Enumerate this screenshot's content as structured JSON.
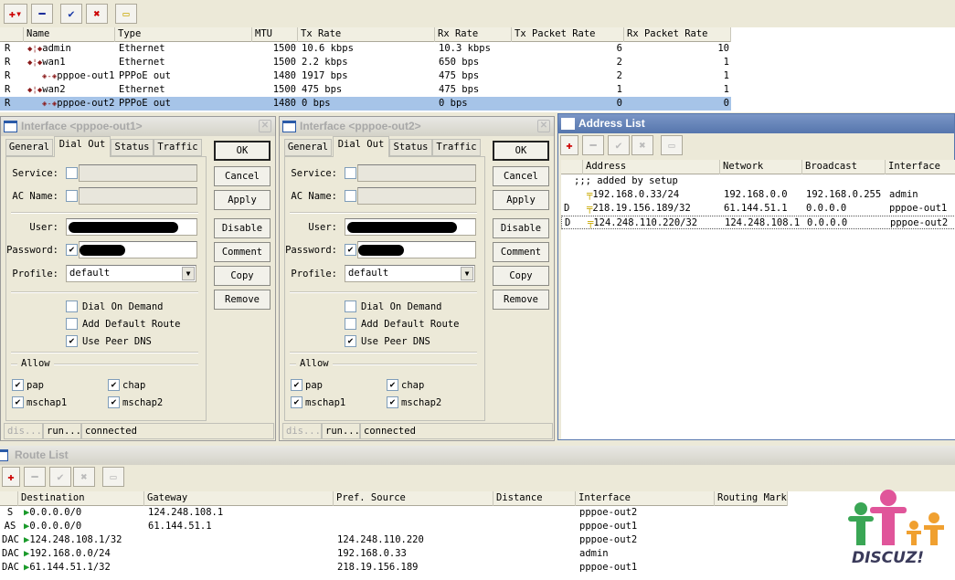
{
  "toolbar": {
    "buttons": [
      {
        "name": "add-menu-button",
        "icon": "plus-dropdown-icon",
        "glyph": "✚▾",
        "color": "#cc0000"
      },
      {
        "name": "remove-button",
        "icon": "minus-icon",
        "glyph": "━",
        "color": "#1a2a9a"
      },
      {
        "name": "enable-button",
        "icon": "check-icon",
        "glyph": "✔",
        "color": "#1a3aa8"
      },
      {
        "name": "disable-button",
        "icon": "x-icon",
        "glyph": "✖",
        "color": "#cc0000"
      },
      {
        "name": "comment-button",
        "icon": "note-icon",
        "glyph": "▭",
        "color": "#c9a800"
      }
    ]
  },
  "interfaces": {
    "columns": [
      "",
      "Name",
      "Type",
      "MTU",
      "Tx Rate",
      "Rx Rate",
      "Tx Packet Rate",
      "Rx Packet Rate"
    ],
    "rows": [
      {
        "flag": "R",
        "name": "admin",
        "indent": false,
        "type": "Ethernet",
        "mtu": "1500",
        "tx": "10.6 kbps",
        "rx": "10.3 kbps",
        "txp": "6",
        "rxp": "10"
      },
      {
        "flag": "R",
        "name": "wan1",
        "indent": false,
        "type": "Ethernet",
        "mtu": "1500",
        "tx": "2.2 kbps",
        "rx": "650 bps",
        "txp": "2",
        "rxp": "1"
      },
      {
        "flag": "R",
        "name": "pppoe-out1",
        "indent": true,
        "type": "PPPoE out",
        "mtu": "1480",
        "tx": "1917 bps",
        "rx": "475 bps",
        "txp": "2",
        "rxp": "1"
      },
      {
        "flag": "R",
        "name": "wan2",
        "indent": false,
        "type": "Ethernet",
        "mtu": "1500",
        "tx": "475 bps",
        "rx": "475 bps",
        "txp": "1",
        "rxp": "1"
      },
      {
        "flag": "R",
        "name": "pppoe-out2",
        "indent": true,
        "type": "PPPoE out",
        "mtu": "1480",
        "tx": "0 bps",
        "rx": "0 bps",
        "txp": "0",
        "rxp": "0",
        "selected": true
      }
    ]
  },
  "dialogs": [
    {
      "title": "Interface <pppoe-out1>",
      "tabs": [
        "General",
        "Dial Out",
        "Status",
        "Traffic"
      ],
      "active_tab": "Dial Out",
      "labels": {
        "service": "Service:",
        "ac_name": "AC Name:",
        "user": "User:",
        "password": "Password:",
        "profile": "Profile:"
      },
      "profile": "default",
      "dial_on_demand": "Dial On Demand",
      "add_default_route": "Add Default Route",
      "use_peer_dns": "Use Peer DNS",
      "allow": "Allow",
      "pap": "pap",
      "chap": "chap",
      "mschap1": "mschap1",
      "mschap2": "mschap2",
      "buttons": [
        "OK",
        "Cancel",
        "Apply",
        "Disable",
        "Comment",
        "Copy",
        "Remove"
      ],
      "status": [
        "dis...",
        "run...",
        "connected"
      ]
    },
    {
      "title": "Interface <pppoe-out2>",
      "tabs": [
        "General",
        "Dial Out",
        "Status",
        "Traffic"
      ],
      "active_tab": "Dial Out",
      "labels": {
        "service": "Service:",
        "ac_name": "AC Name:",
        "user": "User:",
        "password": "Password:",
        "profile": "Profile:"
      },
      "profile": "default",
      "dial_on_demand": "Dial On Demand",
      "add_default_route": "Add Default Route",
      "use_peer_dns": "Use Peer DNS",
      "allow": "Allow",
      "pap": "pap",
      "chap": "chap",
      "mschap1": "mschap1",
      "mschap2": "mschap2",
      "buttons": [
        "OK",
        "Cancel",
        "Apply",
        "Disable",
        "Comment",
        "Copy",
        "Remove"
      ],
      "status": [
        "dis...",
        "run...",
        "connected"
      ]
    }
  ],
  "address_list": {
    "title": "Address List",
    "columns": [
      "",
      "Address",
      "Network",
      "Broadcast",
      "Interface"
    ],
    "comment": ";;; added by setup",
    "rows": [
      {
        "flag": "",
        "address": "192.168.0.33/24",
        "network": "192.168.0.0",
        "broadcast": "192.168.0.255",
        "interface": "admin"
      },
      {
        "flag": "D",
        "address": "218.19.156.189/32",
        "network": "61.144.51.1",
        "broadcast": "0.0.0.0",
        "interface": "pppoe-out1"
      },
      {
        "flag": "D",
        "address": "124.248.110.220/32",
        "network": "124.248.108.1",
        "broadcast": "0.0.0.0",
        "interface": "pppoe-out2"
      }
    ]
  },
  "route_list": {
    "title": "Route List",
    "columns": [
      "",
      "Destination",
      "Gateway",
      "Pref. Source",
      "Distance",
      "Interface",
      "Routing Mark"
    ],
    "rows": [
      {
        "flag": "S",
        "dst": "0.0.0.0/0",
        "gw": "124.248.108.1",
        "src": "",
        "dist": "",
        "iface": "pppoe-out2",
        "mark": ""
      },
      {
        "flag": "AS",
        "dst": "0.0.0.0/0",
        "gw": "61.144.51.1",
        "src": "",
        "dist": "",
        "iface": "pppoe-out1",
        "mark": ""
      },
      {
        "flag": "DAC",
        "dst": "124.248.108.1/32",
        "gw": "",
        "src": "124.248.110.220",
        "dist": "",
        "iface": "pppoe-out2",
        "mark": ""
      },
      {
        "flag": "DAC",
        "dst": "192.168.0.0/24",
        "gw": "",
        "src": "192.168.0.33",
        "dist": "",
        "iface": "admin",
        "mark": ""
      },
      {
        "flag": "DAC",
        "dst": "61.144.51.1/32",
        "gw": "",
        "src": "218.19.156.189",
        "dist": "",
        "iface": "pppoe-out1",
        "mark": ""
      }
    ]
  },
  "watermark": {
    "text": "DISCUZ!",
    "colors": [
      "#3aa655",
      "#e0559a",
      "#f0a030"
    ]
  }
}
